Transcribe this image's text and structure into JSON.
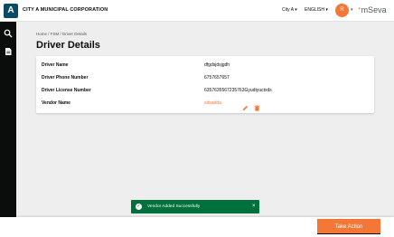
{
  "header": {
    "logo_letter": "A",
    "corporation_name": "CITY A MUNICIPAL CORPORATION",
    "city_select": "City A",
    "language_select": "ENGLISH",
    "avatar_initial": "R",
    "brand": "mSeva"
  },
  "sidebar": {
    "icons": [
      "search-icon",
      "document-icon"
    ]
  },
  "main": {
    "breadcrumb": "Home / FSM / Driver Details",
    "title": "Driver Details",
    "details": [
      {
        "label": "Driver Name",
        "value": "dfgdsjdsjgdh"
      },
      {
        "label": "Driver Phone Number",
        "value": "6757657657"
      },
      {
        "label": "Driver License Number",
        "value": "6357635567235763Gyudtyuctxds"
      },
      {
        "label": "Vendor Name",
        "value": "sdsadda"
      }
    ]
  },
  "toast": {
    "message": "Vendor Added Successfully",
    "close_glyph": "×"
  },
  "actions": {
    "take_action_label": "Take Action"
  },
  "colors": {
    "primary": "#f47738",
    "sidebar": "#0b0c0c",
    "success": "#00703c",
    "logo": "#0b4b66"
  }
}
